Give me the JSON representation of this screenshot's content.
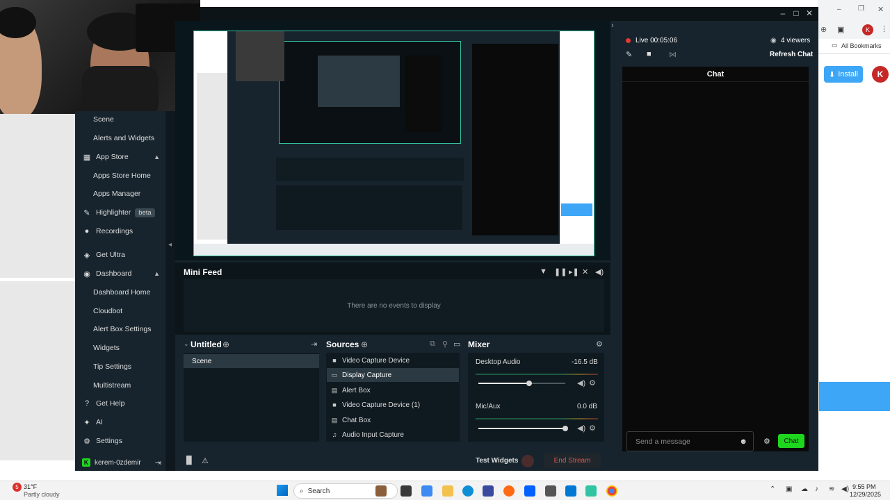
{
  "browser": {
    "bookmarks_label": "All Bookmarks",
    "install_label": "Install",
    "avatar_letter": "K"
  },
  "app": {
    "window_controls": [
      "–",
      "□",
      "✕"
    ]
  },
  "sidebar": {
    "items": [
      {
        "label": "Scene",
        "icon": "scene",
        "sub": true
      },
      {
        "label": "Alerts and Widgets",
        "icon": "",
        "sub": true
      },
      {
        "label": "App Store",
        "icon": "app-store-icon",
        "sub": false,
        "expanded": true
      },
      {
        "label": "Apps Store Home",
        "icon": "",
        "sub": true
      },
      {
        "label": "Apps Manager",
        "icon": "",
        "sub": true
      },
      {
        "label": "Highlighter",
        "icon": "highlighter-icon",
        "sub": false,
        "badge": "beta"
      },
      {
        "label": "Recordings",
        "icon": "record-icon",
        "sub": false
      },
      {
        "label": "Get Ultra",
        "icon": "ultra-icon",
        "sub": false
      },
      {
        "label": "Dashboard",
        "icon": "dashboard-icon",
        "sub": false,
        "expanded": true
      },
      {
        "label": "Dashboard Home",
        "icon": "",
        "sub": true
      },
      {
        "label": "Cloudbot",
        "icon": "",
        "sub": true
      },
      {
        "label": "Alert Box Settings",
        "icon": "",
        "sub": true
      },
      {
        "label": "Widgets",
        "icon": "",
        "sub": true
      },
      {
        "label": "Tip Settings",
        "icon": "",
        "sub": true
      },
      {
        "label": "Multistream",
        "icon": "",
        "sub": true
      },
      {
        "label": "Get Help",
        "icon": "help-icon",
        "sub": false
      },
      {
        "label": "AI",
        "icon": "ai-icon",
        "sub": false
      },
      {
        "label": "Settings",
        "icon": "gear-icon",
        "sub": false
      }
    ],
    "user": "kerem-0zdemir"
  },
  "minifeed": {
    "title": "Mini Feed",
    "empty_text": "There are no events to display"
  },
  "scenes": {
    "title": "Untitled",
    "items": [
      "Scene"
    ]
  },
  "sources": {
    "title": "Sources",
    "items": [
      {
        "label": "Video Capture Device",
        "icon": "camera-icon",
        "selected": false
      },
      {
        "label": "Display Capture",
        "icon": "monitor-icon",
        "selected": true
      },
      {
        "label": "Alert Box",
        "icon": "alert-box-icon",
        "selected": false
      },
      {
        "label": "Video Capture Device (1)",
        "icon": "camera-icon",
        "selected": false
      },
      {
        "label": "Chat Box",
        "icon": "chat-box-icon",
        "selected": false
      },
      {
        "label": "Audio Input Capture",
        "icon": "mic-icon",
        "selected": false
      }
    ]
  },
  "mixer": {
    "title": "Mixer",
    "channels": [
      {
        "name": "Desktop Audio",
        "level": "-16.5 dB",
        "volume_fraction": 0.58
      },
      {
        "name": "Mic/Aux",
        "level": "0.0 dB",
        "volume_fraction": 1.0
      }
    ]
  },
  "footer": {
    "test_widgets": "Test Widgets",
    "end_stream": "End Stream"
  },
  "live": {
    "status": "Live 00:05:06",
    "viewers": "4 viewers",
    "refresh": "Refresh Chat"
  },
  "chat": {
    "title": "Chat",
    "input_placeholder": "Send a message",
    "send_label": "Chat"
  },
  "taskbar": {
    "weather_temp": "31°F",
    "weather_desc": "Partly cloudy",
    "weather_badge": "5",
    "search_label": "Search",
    "time": "9:55 PM",
    "date": "12/29/2025"
  },
  "colors": {
    "accent_green": "#1fd61f",
    "live_red": "#e53935",
    "end_stream_red": "#e3564b",
    "preview_border": "#31c3a2"
  }
}
